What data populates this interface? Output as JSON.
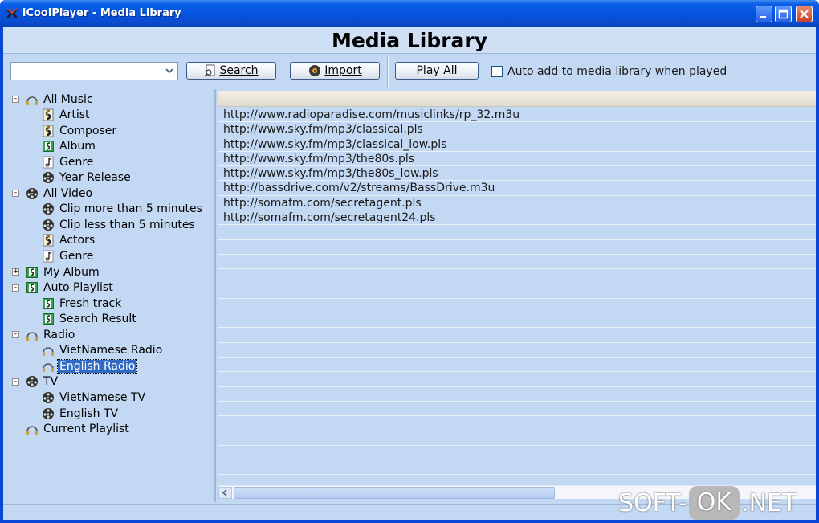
{
  "window": {
    "title": "iCoolPlayer - Media Library"
  },
  "header": {
    "title": "Media Library"
  },
  "toolbar": {
    "search_value": "",
    "search_label": "Search",
    "import_label": "Import",
    "play_all_label": "Play All",
    "auto_add_label": "Auto add to media library when played",
    "auto_add_checked": false
  },
  "tree": {
    "items": [
      {
        "label": "All Music",
        "icon": "radio-icon"
      },
      {
        "label": "Artist",
        "icon": "artist-icon"
      },
      {
        "label": "Composer",
        "icon": "artist-icon"
      },
      {
        "label": "Album",
        "icon": "album-icon"
      },
      {
        "label": "Genre",
        "icon": "music-note-icon"
      },
      {
        "label": "Year Release",
        "icon": "film-reel-icon"
      },
      {
        "label": "All Video",
        "icon": "film-reel-icon"
      },
      {
        "label": "Clip more than 5 minutes",
        "icon": "film-reel-icon"
      },
      {
        "label": "Clip less than 5 minutes",
        "icon": "film-reel-icon"
      },
      {
        "label": "Actors",
        "icon": "artist-icon"
      },
      {
        "label": "Genre",
        "icon": "music-note-icon"
      },
      {
        "label": "My Album",
        "icon": "album-icon"
      },
      {
        "label": "Auto Playlist",
        "icon": "album-icon"
      },
      {
        "label": "Fresh track",
        "icon": "album-icon"
      },
      {
        "label": "Search Result",
        "icon": "album-icon"
      },
      {
        "label": "Radio",
        "icon": "radio-icon"
      },
      {
        "label": "VietNamese Radio",
        "icon": "radio-icon"
      },
      {
        "label": "English Radio",
        "icon": "radio-icon",
        "selected": true
      },
      {
        "label": "TV",
        "icon": "film-reel-icon"
      },
      {
        "label": "VietNamese TV",
        "icon": "film-reel-icon"
      },
      {
        "label": "English TV",
        "icon": "film-reel-icon"
      },
      {
        "label": "Current Playlist",
        "icon": "radio-icon"
      }
    ]
  },
  "list": {
    "rows": [
      "http://www.radioparadise.com/musiclinks/rp_32.m3u",
      "http://www.sky.fm/mp3/classical.pls",
      "http://www.sky.fm/mp3/classical_low.pls",
      "http://www.sky.fm/mp3/the80s.pls",
      "http://www.sky.fm/mp3/the80s_low.pls",
      "http://bassdrive.com/v2/streams/BassDrive.m3u",
      "http://somafm.com/secretagent.pls",
      "http://somafm.com/secretagent24.pls"
    ]
  },
  "watermark": {
    "left": "SOFT-",
    "mid": "OK",
    "right": ".NET"
  },
  "colors": {
    "title_bar": "#0554e0",
    "panel": "#c3d8f2",
    "selection": "#316ac5"
  }
}
